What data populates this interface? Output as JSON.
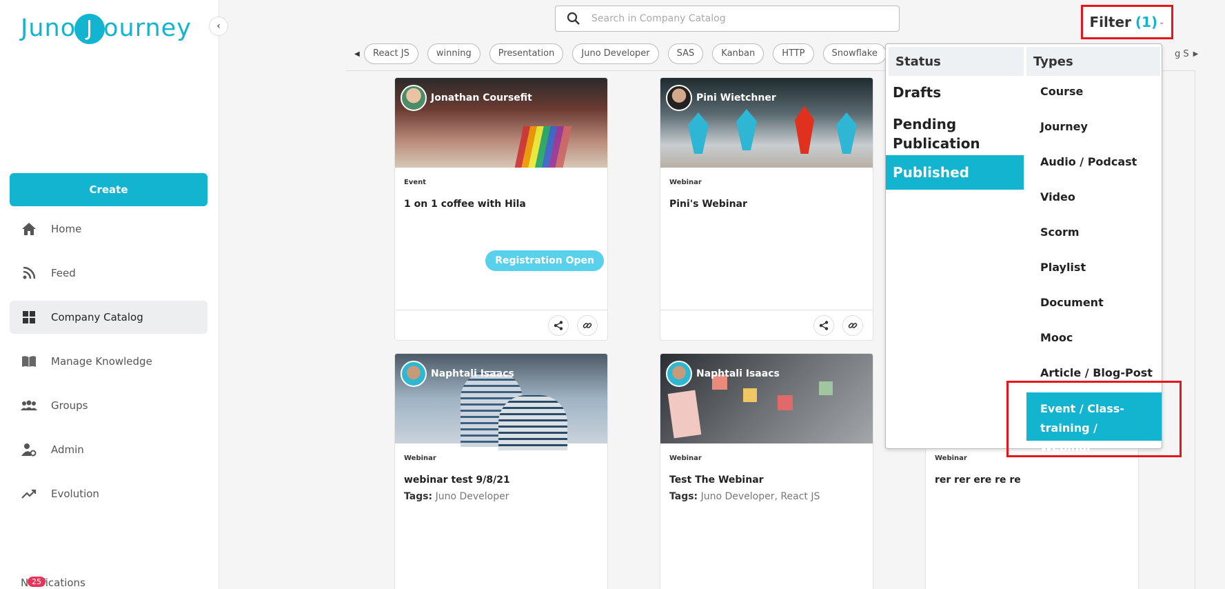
{
  "brand": {
    "logo_pre": "Juno",
    "logo_mid": "J",
    "logo_post": "ourney"
  },
  "sidebar": {
    "create_label": "Create",
    "items": [
      {
        "label": "Home"
      },
      {
        "label": "Feed"
      },
      {
        "label": "Company Catalog"
      },
      {
        "label": "Manage Knowledge"
      },
      {
        "label": "Groups"
      },
      {
        "label": "Admin"
      },
      {
        "label": "Evolution"
      }
    ],
    "notification_count": "25",
    "notification_label": "Notifications"
  },
  "search": {
    "placeholder": "Search in Company Catalog"
  },
  "filter": {
    "label": "Filter",
    "count": "(1)"
  },
  "tags": [
    "React JS",
    "winning",
    "Presentation",
    "Juno Developer",
    "SAS",
    "Kanban",
    "HTTP",
    "Snowflake"
  ],
  "tags_tail": "g S",
  "cards": [
    {
      "author": "Jonathan Coursefit",
      "type": "Event",
      "title": "1 on 1 coffee with Hila",
      "badge": "Registration Open"
    },
    {
      "author": "Pini Wietchner",
      "type": "Webinar",
      "title": "Pini's Webinar"
    },
    {
      "author": "Naphtali Isaacs",
      "type": "Webinar",
      "title": "webinar test 9/8/21",
      "tags_label": "Tags:",
      "tags": "Juno Developer"
    },
    {
      "author": "Naphtali Isaacs",
      "type": "Webinar",
      "title": "Test The Webinar",
      "tags_label": "Tags:",
      "tags": "Juno Developer, React JS"
    },
    {
      "type": "Webinar",
      "title": "rer rer ere re re"
    }
  ],
  "dropdown": {
    "status_heading": "Status",
    "types_heading": "Types",
    "status": [
      "Drafts",
      "Pending Publication",
      "Published"
    ],
    "types": [
      "Course",
      "Journey",
      "Audio / Podcast",
      "Video",
      "Scorm",
      "Playlist",
      "Document",
      "Mooc",
      "Article / Blog-Post",
      "Event / Class-training / Webinar"
    ]
  },
  "colors": {
    "accent": "#13b4cf",
    "highlight": "#e8141c",
    "badge": "#e8335a"
  }
}
